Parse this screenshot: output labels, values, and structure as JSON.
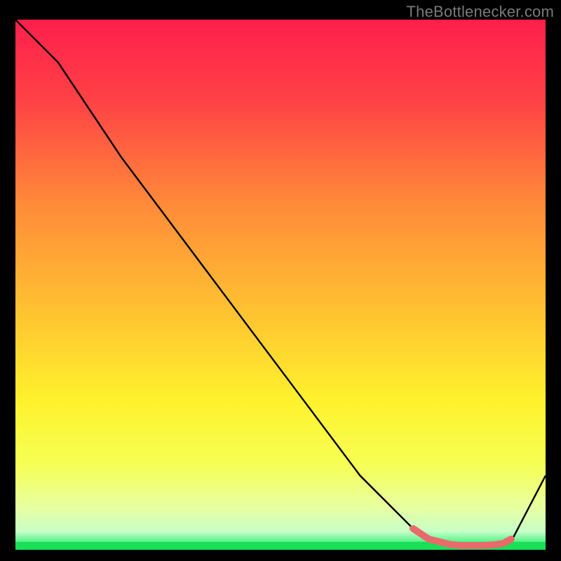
{
  "attribution": "TheBottlenecker.com",
  "colors": {
    "background": "#000000",
    "attribution_text": "#7a7a7a",
    "curve": "#000000",
    "highlight": "#e96a6a",
    "bottom_band": "#18e057",
    "gradient_stops": [
      {
        "offset": 0.0,
        "color": "#ff1f4c"
      },
      {
        "offset": 0.15,
        "color": "#ff4146"
      },
      {
        "offset": 0.35,
        "color": "#ff8b39"
      },
      {
        "offset": 0.55,
        "color": "#ffc231"
      },
      {
        "offset": 0.72,
        "color": "#fff22d"
      },
      {
        "offset": 0.84,
        "color": "#f6ff55"
      },
      {
        "offset": 0.92,
        "color": "#e7ffa0"
      },
      {
        "offset": 0.965,
        "color": "#c8ffc8"
      },
      {
        "offset": 0.985,
        "color": "#59f28a"
      },
      {
        "offset": 1.0,
        "color": "#18e057"
      }
    ]
  },
  "chart_data": {
    "type": "line",
    "title": "",
    "xlabel": "",
    "ylabel": "",
    "xlim": [
      0,
      100
    ],
    "ylim": [
      0,
      100
    ],
    "grid": false,
    "x": [
      0,
      8,
      20,
      35,
      50,
      65,
      75,
      80,
      82,
      84,
      86,
      88,
      90,
      92,
      94,
      100
    ],
    "values": [
      100,
      92,
      74,
      54,
      34,
      14,
      4,
      1.5,
      1,
      0.8,
      0.8,
      0.8,
      0.9,
      1.2,
      2.5,
      14
    ],
    "highlight_segment": {
      "x": [
        75,
        78,
        80,
        82,
        84,
        86,
        88,
        90,
        92,
        93.5
      ],
      "values": [
        4,
        2,
        1.5,
        1,
        0.8,
        0.8,
        0.8,
        0.9,
        1.2,
        2
      ]
    },
    "annotations": []
  }
}
